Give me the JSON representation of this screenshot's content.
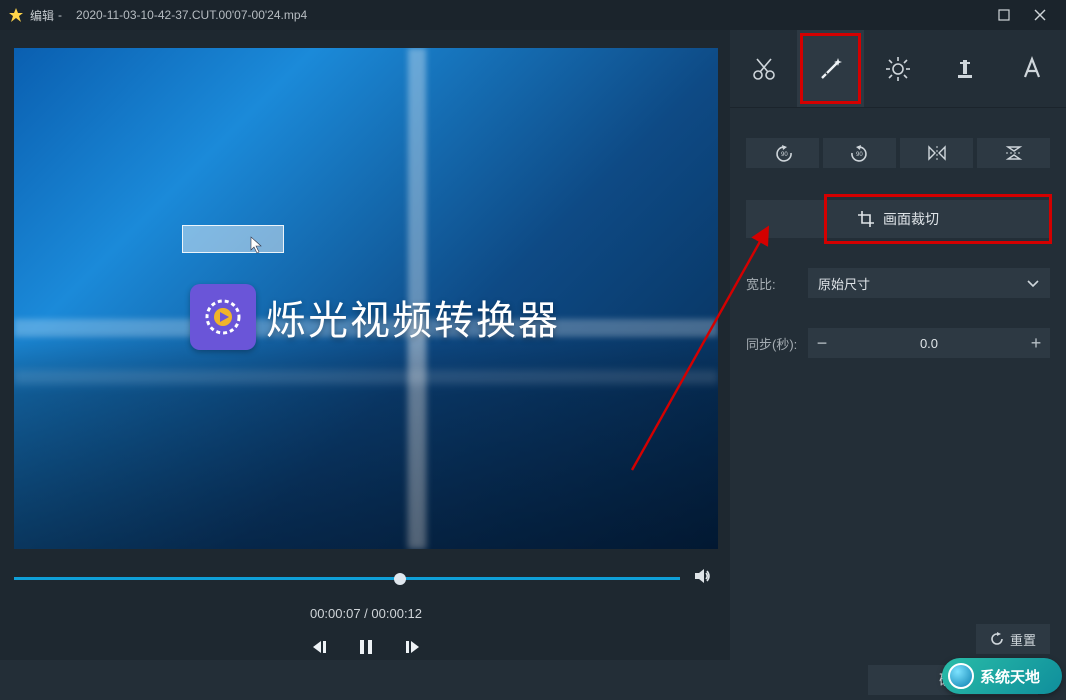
{
  "titlebar": {
    "title": "编辑",
    "filename": "2020-11-03-10-42-37.CUT.00'07-00'24.mp4"
  },
  "video": {
    "overlay_brand": "烁光视频转换器"
  },
  "player": {
    "current_time": "00:00:07",
    "duration": "00:00:12",
    "time_display": "00:00:07 / 00:00:12"
  },
  "panel": {
    "crop_label": "画面裁切",
    "ratio_label": "宽比:",
    "ratio_value": "原始尺寸",
    "sync_label": "同步(秒):",
    "sync_value": "0.0",
    "reset_label": "重置"
  },
  "footer": {
    "ok_label": "确定"
  },
  "watermark": {
    "text": "系统天地"
  }
}
